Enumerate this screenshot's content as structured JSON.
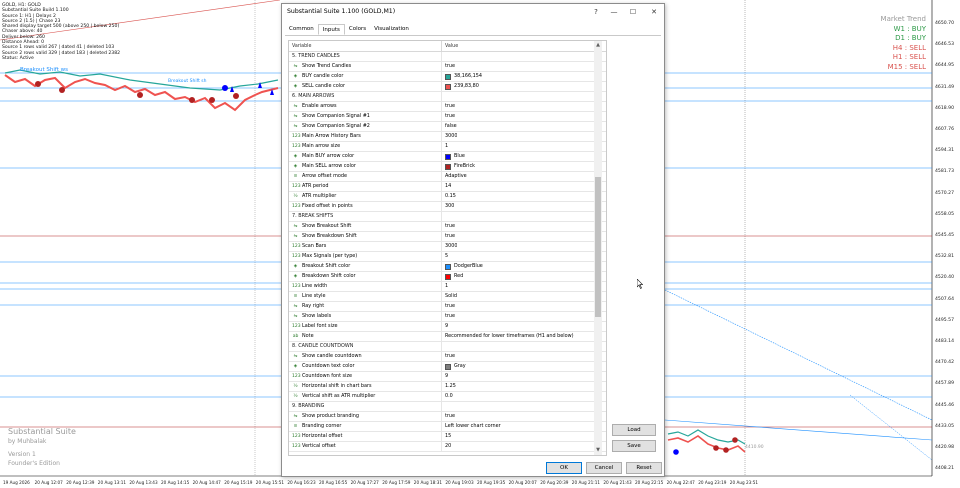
{
  "chart": {
    "info_lines": [
      "GOLD, H1: GOLD",
      "Substantial Suite Build 1.100",
      "Source 1: H1 | Delays 2",
      "Source 2 (1.5) | Chase 23",
      "Shared display target 500 (above 250 | below 250)",
      "Chaser above: 40",
      "Deliver below: 260",
      "Distance Ahead: 0",
      "Source 1 rows valid 267 | dated 41 | deleted 103",
      "Source 2 rows valid 329 | dated 183 | deleted 2382",
      "Status: Active"
    ],
    "annotations": {
      "breakout_label": "Breakout Shift ws",
      "partial_label": "Breakout Shift sh"
    },
    "market_trend": {
      "title": "Market Trend",
      "items": [
        {
          "label": "W1 : BUY",
          "color": "#2e9a48"
        },
        {
          "label": "D1 : BUY",
          "color": "#2e9a48"
        },
        {
          "label": "H4 : SELL",
          "color": "#d9534f"
        },
        {
          "label": "H1 : SELL",
          "color": "#d9534f"
        },
        {
          "label": "M15 : SELL",
          "color": "#d9534f"
        }
      ]
    },
    "branding": {
      "line1": "Substantial Suite",
      "line2": "by Muhbalak",
      "line3": "Version 1",
      "line4": "Founder's Edition"
    },
    "price_labels": [
      "4650.70",
      "4646.53",
      "4644.95",
      "4631.49",
      "4618.90",
      "4607.76",
      "4594.31",
      "4581.73",
      "4570.27",
      "4558.05",
      "4545.45",
      "4532.81",
      "4520.40",
      "4507.64",
      "4495.57",
      "4483.14",
      "4470.42",
      "4457.89",
      "4445.46",
      "4433.05",
      "4420.98",
      "4408.21"
    ],
    "time_labels": [
      "19 Aug 2026",
      "20 Aug 12:07",
      "20 Aug 12:39",
      "20 Aug 13:11",
      "20 Aug 13:43",
      "20 Aug 14:15",
      "20 Aug 14:47",
      "20 Aug 15:19",
      "20 Aug 15:51",
      "20 Aug 16:23",
      "20 Aug 16:55",
      "20 Aug 17:27",
      "20 Aug 17:59",
      "20 Aug 18:31",
      "20 Aug 19:03",
      "20 Aug 19:35",
      "20 Aug 20:07",
      "20 Aug 20:39",
      "20 Aug 21:11",
      "20 Aug 21:43",
      "20 Aug 22:15",
      "20 Aug 22:47",
      "20 Aug 23:19",
      "20 Aug 23:51"
    ],
    "overlay_price": "4410.90"
  },
  "dialog": {
    "title": "Substantial Suite 1.100 (GOLD,M1)",
    "tabs": [
      "Common",
      "Inputs",
      "Colors",
      "Visualization"
    ],
    "active_tab": "Inputs",
    "columns": {
      "variable": "Variable",
      "value": "Value"
    },
    "rows": [
      {
        "type": "section",
        "label": "5. TREND CANDLES"
      },
      {
        "icon": "toggle",
        "label": "Show Trend Candles",
        "value": "true"
      },
      {
        "icon": "color",
        "label": "BUY candle color",
        "value": "38,166,154",
        "swatch": "#26a69a"
      },
      {
        "icon": "color",
        "label": "SELL candle color",
        "value": "239,83,80",
        "swatch": "#ef5350"
      },
      {
        "type": "section",
        "label": "6. MAIN ARROWS"
      },
      {
        "icon": "toggle",
        "label": "Enable arrows",
        "value": "true"
      },
      {
        "icon": "toggle",
        "label": "Show Companion Signal #1",
        "value": "true"
      },
      {
        "icon": "toggle",
        "label": "Show Companion Signal #2",
        "value": "false"
      },
      {
        "icon": "int",
        "label": "Main Arrow History Bars",
        "value": "3000"
      },
      {
        "icon": "int",
        "label": "Main arrow size",
        "value": "1"
      },
      {
        "icon": "color",
        "label": "Main BUY arrow color",
        "value": "Blue",
        "swatch": "#0000ff"
      },
      {
        "icon": "color",
        "label": "Main SELL arrow color",
        "value": "FireBrick",
        "swatch": "#b22222"
      },
      {
        "icon": "enum",
        "label": "Arrow offset mode",
        "value": "Adaptive"
      },
      {
        "icon": "int",
        "label": "ATR period",
        "value": "14"
      },
      {
        "icon": "double",
        "label": "ATR multiplier",
        "value": "0.15"
      },
      {
        "icon": "int",
        "label": "Fixed offset in points",
        "value": "300"
      },
      {
        "type": "section",
        "label": "7. BREAK SHIFTS"
      },
      {
        "icon": "toggle",
        "label": "Show Breakout Shift",
        "value": "true"
      },
      {
        "icon": "toggle",
        "label": "Show Breakdown Shift",
        "value": "true"
      },
      {
        "icon": "int",
        "label": "Scan Bars",
        "value": "3000"
      },
      {
        "icon": "int",
        "label": "Max Signals (per type)",
        "value": "5"
      },
      {
        "icon": "color",
        "label": "Breakout Shift color",
        "value": "DodgerBlue",
        "swatch": "#1e90ff"
      },
      {
        "icon": "color",
        "label": "Breakdown Shift color",
        "value": "Red",
        "swatch": "#ff0000"
      },
      {
        "icon": "int",
        "label": "Line width",
        "value": "1"
      },
      {
        "icon": "enum",
        "label": "Line style",
        "value": "Solid"
      },
      {
        "icon": "toggle",
        "label": "Ray right",
        "value": "true"
      },
      {
        "icon": "toggle",
        "label": "Show labels",
        "value": "true"
      },
      {
        "icon": "int",
        "label": "Label font size",
        "value": "9"
      },
      {
        "icon": "string",
        "label": "Note",
        "value": "Recommended for lower timeframes (H1 and below)"
      },
      {
        "type": "section",
        "label": "8. CANDLE COUNTDOWN"
      },
      {
        "icon": "toggle",
        "label": "Show candle countdown",
        "value": "true"
      },
      {
        "icon": "color",
        "label": "Countdown text color",
        "value": "Gray",
        "swatch": "#808080"
      },
      {
        "icon": "int",
        "label": "Countdown font size",
        "value": "9"
      },
      {
        "icon": "double",
        "label": "Horizontal shift in chart bars",
        "value": "1.25"
      },
      {
        "icon": "double",
        "label": "Vertical shift as ATR multiplier",
        "value": "0.0"
      },
      {
        "type": "section",
        "label": "9. BRANDING"
      },
      {
        "icon": "toggle",
        "label": "Show product branding",
        "value": "true"
      },
      {
        "icon": "enum",
        "label": "Branding corner",
        "value": "Left lower chart corner"
      },
      {
        "icon": "int",
        "label": "Horizontal offset",
        "value": "15"
      },
      {
        "icon": "int",
        "label": "Vertical offset",
        "value": "20"
      }
    ],
    "buttons": {
      "load": "Load",
      "save": "Save",
      "ok": "OK",
      "cancel": "Cancel",
      "reset": "Reset"
    }
  }
}
